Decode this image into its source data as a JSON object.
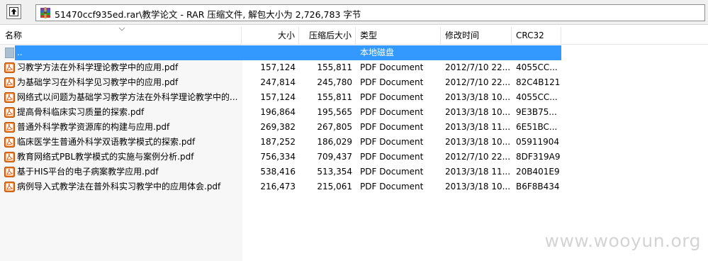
{
  "address": {
    "path": "51470ccf935ed.rar\\教学论文 - RAR 压缩文件, 解包大小为 2,726,783 字节"
  },
  "columns": {
    "name": "名称",
    "size": "大小",
    "packed": "压缩后大小",
    "type": "类型",
    "mtime": "修改时间",
    "crc": "CRC32"
  },
  "parent_row": {
    "name": "..",
    "type": "本地磁盘"
  },
  "files": [
    {
      "name": "习教学方法在外科学理论教学中的应用.pdf",
      "size": "157,124",
      "packed": "155,811",
      "type": "PDF Document",
      "mtime": "2012/7/10 22...",
      "crc": "4055CC..."
    },
    {
      "name": "为基础学习在外科学见习教学中的应用.pdf",
      "size": "247,814",
      "packed": "245,780",
      "type": "PDF Document",
      "mtime": "2012/7/10 22...",
      "crc": "82C4B121"
    },
    {
      "name": "网络式以问题为基础学习教学方法在外科学理论教学中的...",
      "size": "157,124",
      "packed": "155,811",
      "type": "PDF Document",
      "mtime": "2013/3/18 10...",
      "crc": "4055CC..."
    },
    {
      "name": "提高骨科临床实习质量的探索.pdf",
      "size": "196,864",
      "packed": "195,565",
      "type": "PDF Document",
      "mtime": "2013/3/18 10...",
      "crc": "9E3B75..."
    },
    {
      "name": "普通外科学教学资源库的构建与应用.pdf",
      "size": "269,382",
      "packed": "267,805",
      "type": "PDF Document",
      "mtime": "2013/3/18 11...",
      "crc": "6E51BC..."
    },
    {
      "name": "临床医学生普通外科学双语教学模式的探索.pdf",
      "size": "187,252",
      "packed": "186,029",
      "type": "PDF Document",
      "mtime": "2013/3/18 10...",
      "crc": "05911904"
    },
    {
      "name": "教育网络式PBL教学模式的实施与案例分析.pdf",
      "size": "756,334",
      "packed": "709,437",
      "type": "PDF Document",
      "mtime": "2012/7/10 22...",
      "crc": "8DF319A9"
    },
    {
      "name": "基于HIS平台的电子病案教学应用.pdf",
      "size": "538,416",
      "packed": "513,354",
      "type": "PDF Document",
      "mtime": "2013/3/18 11...",
      "crc": "20B401E9"
    },
    {
      "name": "病例导入式教学法在普外科实习教学中的应用体会.pdf",
      "size": "216,473",
      "packed": "215,061",
      "type": "PDF Document",
      "mtime": "2013/3/18 10...",
      "crc": "B6F8B434"
    }
  ],
  "icons": {
    "up": "folder-up-icon",
    "archive": "rar-archive-icon",
    "parent": "parent-folder-icon",
    "file": "pdf-file-icon",
    "sort": "sort-arrow-icon"
  },
  "colors": {
    "selection": "#3399ff",
    "pdf_icon": "#e8761c"
  },
  "watermark": "www.wooyun.org"
}
